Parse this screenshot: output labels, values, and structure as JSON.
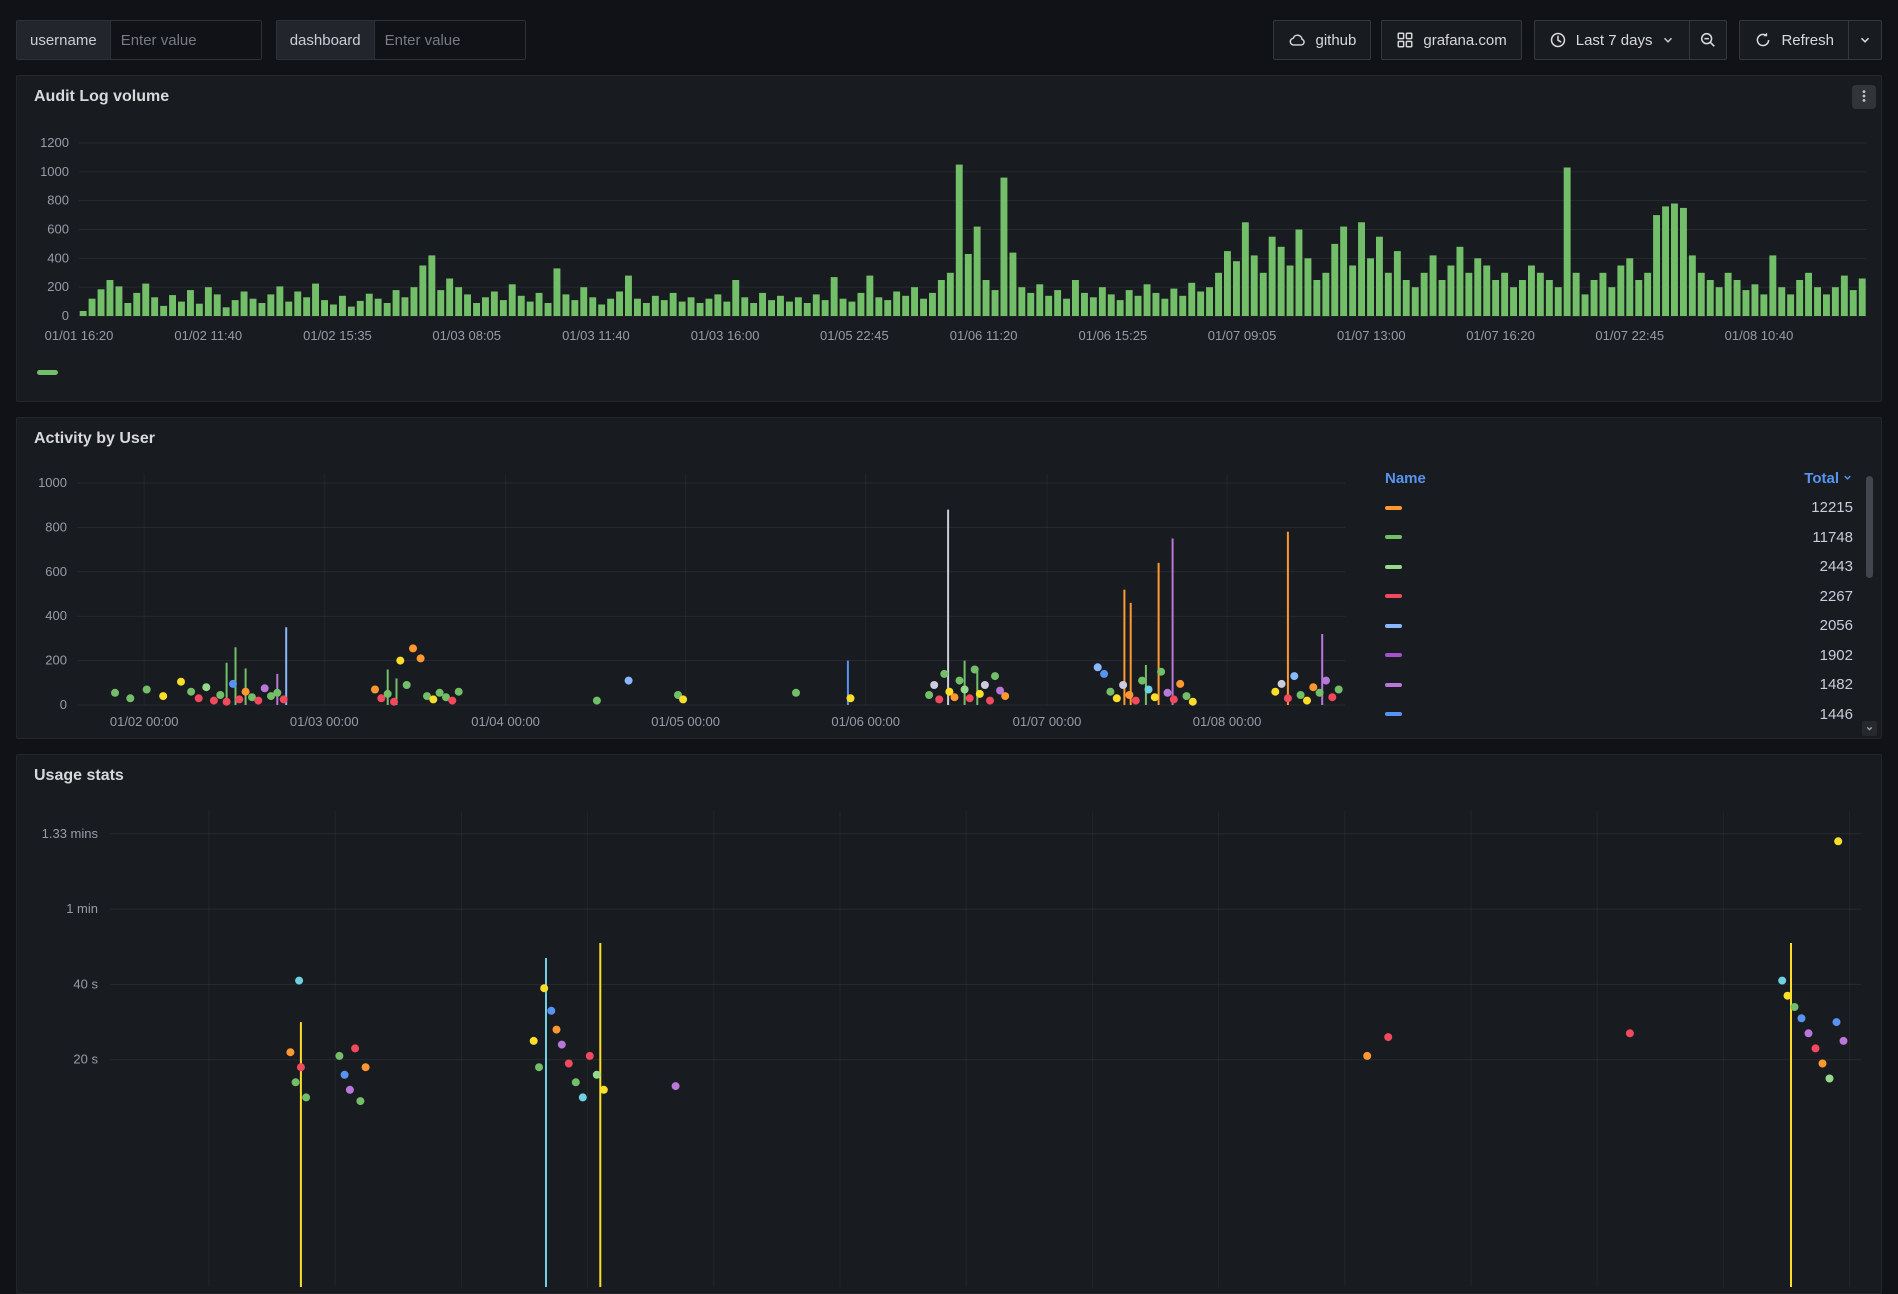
{
  "topbar": {
    "variables": [
      {
        "label": "username",
        "placeholder": "Enter value"
      },
      {
        "label": "dashboard",
        "placeholder": "Enter value"
      }
    ],
    "github_label": "github",
    "grafana_label": "grafana.com",
    "time_range_label": "Last 7 days",
    "refresh_label": "Refresh"
  },
  "icons": [
    "cloud-icon",
    "apps-grid-icon",
    "clock-icon",
    "chevron-down-icon",
    "zoom-out-icon",
    "refresh-icon",
    "kebab-menu-icon",
    "sort-desc-icon",
    "scroll-down-icon"
  ],
  "palette": {
    "G": "#73bf69",
    "Y": "#fade2a",
    "O": "#ff9830",
    "R": "#f2495c",
    "B": "#5794f2",
    "P": "#b877d9",
    "LB": "#8ab8ff",
    "LG": "#96d98d",
    "T": "#6ed0e0",
    "W": "#ccccdc",
    "V": "#a352cc"
  },
  "chart_data": [
    {
      "id": "audit",
      "type": "bar",
      "title": "Audit Log volume",
      "color": "#73bf69",
      "ylim": [
        0,
        1200
      ],
      "yticks": [
        0,
        200,
        400,
        600,
        800,
        1000,
        1200
      ],
      "xticks": [
        "01/01 16:20",
        "01/02 11:40",
        "01/02 15:35",
        "01/03 08:05",
        "01/03 11:40",
        "01/03 16:00",
        "01/05 22:45",
        "01/06 11:20",
        "01/06 15:25",
        "01/07 09:05",
        "01/07 13:00",
        "01/07 16:20",
        "01/07 22:45",
        "01/08 10:40"
      ],
      "values": [
        35,
        120,
        185,
        250,
        205,
        90,
        160,
        225,
        130,
        70,
        145,
        100,
        180,
        85,
        200,
        150,
        60,
        110,
        170,
        120,
        90,
        150,
        205,
        100,
        170,
        130,
        225,
        110,
        80,
        140,
        65,
        105,
        155,
        120,
        90,
        180,
        130,
        200,
        350,
        420,
        180,
        260,
        200,
        150,
        90,
        130,
        170,
        110,
        220,
        140,
        100,
        160,
        90,
        330,
        150,
        110,
        200,
        130,
        80,
        120,
        170,
        280,
        120,
        90,
        140,
        110,
        160,
        100,
        130,
        90,
        120,
        150,
        100,
        250,
        130,
        90,
        160,
        110,
        140,
        100,
        130,
        90,
        150,
        110,
        270,
        120,
        100,
        160,
        280,
        130,
        110,
        170,
        140,
        200,
        120,
        160,
        250,
        300,
        1050,
        430,
        620,
        250,
        180,
        960,
        440,
        200,
        160,
        220,
        140,
        180,
        120,
        250,
        160,
        130,
        200,
        150,
        110,
        180,
        140,
        220,
        160,
        120,
        190,
        140,
        230,
        170,
        200,
        300,
        450,
        380,
        650,
        420,
        300,
        550,
        480,
        350,
        600,
        400,
        250,
        300,
        500,
        620,
        350,
        650,
        400,
        550,
        300,
        450,
        250,
        200,
        300,
        420,
        250,
        350,
        480,
        300,
        400,
        350,
        250,
        300,
        200,
        250,
        350,
        300,
        250,
        200,
        1030,
        300,
        150,
        250,
        300,
        200,
        350,
        400,
        250,
        300,
        700,
        760,
        780,
        750,
        420,
        300,
        250,
        200,
        300,
        250,
        180,
        220,
        150,
        420,
        200,
        150,
        250,
        300,
        200,
        150,
        200,
        280,
        180,
        260
      ]
    },
    {
      "id": "activity",
      "type": "scatter",
      "title": "Activity by User",
      "ylim": [
        0,
        1000
      ],
      "yticks": [
        0,
        200,
        400,
        600,
        800,
        1000
      ],
      "xticks": [
        {
          "label": "01/02 00:00",
          "f": 0.053
        },
        {
          "label": "01/03 00:00",
          "f": 0.195
        },
        {
          "label": "01/04 00:00",
          "f": 0.338
        },
        {
          "label": "01/05 00:00",
          "f": 0.48
        },
        {
          "label": "01/06 00:00",
          "f": 0.622
        },
        {
          "label": "01/07 00:00",
          "f": 0.765
        },
        {
          "label": "01/08 00:00",
          "f": 0.907
        }
      ],
      "points": [
        [
          0.03,
          55,
          "G"
        ],
        [
          0.042,
          30,
          "G"
        ],
        [
          0.055,
          70,
          "G"
        ],
        [
          0.068,
          40,
          "Y"
        ],
        [
          0.082,
          105,
          "Y"
        ],
        [
          0.09,
          60,
          "G"
        ],
        [
          0.096,
          30,
          "R"
        ],
        [
          0.102,
          80,
          "LG"
        ],
        [
          0.108,
          20,
          "R"
        ],
        [
          0.113,
          45,
          "G"
        ],
        [
          0.118,
          15,
          "R"
        ],
        [
          0.123,
          95,
          "B"
        ],
        [
          0.128,
          25,
          "R"
        ],
        [
          0.133,
          60,
          "O"
        ],
        [
          0.138,
          35,
          "G"
        ],
        [
          0.143,
          20,
          "R"
        ],
        [
          0.148,
          75,
          "P"
        ],
        [
          0.153,
          40,
          "G"
        ],
        [
          0.158,
          55,
          "G"
        ],
        [
          0.163,
          25,
          "R"
        ],
        [
          0.235,
          70,
          "O"
        ],
        [
          0.24,
          30,
          "R"
        ],
        [
          0.245,
          50,
          "G"
        ],
        [
          0.25,
          15,
          "R"
        ],
        [
          0.255,
          200,
          "Y"
        ],
        [
          0.26,
          90,
          "G"
        ],
        [
          0.265,
          255,
          "O"
        ],
        [
          0.271,
          210,
          "O"
        ],
        [
          0.276,
          40,
          "G"
        ],
        [
          0.281,
          25,
          "Y"
        ],
        [
          0.286,
          55,
          "G"
        ],
        [
          0.291,
          35,
          "G"
        ],
        [
          0.296,
          20,
          "R"
        ],
        [
          0.301,
          60,
          "G"
        ],
        [
          0.41,
          20,
          "G"
        ],
        [
          0.435,
          110,
          "LB"
        ],
        [
          0.474,
          45,
          "G"
        ],
        [
          0.478,
          25,
          "Y"
        ],
        [
          0.567,
          55,
          "G"
        ],
        [
          0.61,
          30,
          "Y"
        ],
        [
          0.672,
          45,
          "G"
        ],
        [
          0.676,
          90,
          "W"
        ],
        [
          0.68,
          25,
          "R"
        ],
        [
          0.684,
          140,
          "G"
        ],
        [
          0.688,
          60,
          "Y"
        ],
        [
          0.692,
          35,
          "O"
        ],
        [
          0.696,
          110,
          "G"
        ],
        [
          0.7,
          70,
          "LG"
        ],
        [
          0.704,
          30,
          "R"
        ],
        [
          0.708,
          160,
          "G"
        ],
        [
          0.712,
          50,
          "Y"
        ],
        [
          0.716,
          90,
          "W"
        ],
        [
          0.72,
          20,
          "R"
        ],
        [
          0.724,
          130,
          "G"
        ],
        [
          0.728,
          65,
          "P"
        ],
        [
          0.732,
          40,
          "O"
        ],
        [
          0.805,
          170,
          "LB"
        ],
        [
          0.81,
          140,
          "B"
        ],
        [
          0.815,
          60,
          "G"
        ],
        [
          0.82,
          30,
          "Y"
        ],
        [
          0.825,
          90,
          "W"
        ],
        [
          0.83,
          45,
          "O"
        ],
        [
          0.835,
          20,
          "R"
        ],
        [
          0.84,
          110,
          "G"
        ],
        [
          0.845,
          70,
          "T"
        ],
        [
          0.85,
          35,
          "Y"
        ],
        [
          0.855,
          150,
          "G"
        ],
        [
          0.86,
          55,
          "P"
        ],
        [
          0.865,
          25,
          "R"
        ],
        [
          0.87,
          95,
          "O"
        ],
        [
          0.875,
          40,
          "G"
        ],
        [
          0.88,
          15,
          "Y"
        ],
        [
          0.945,
          60,
          "Y"
        ],
        [
          0.95,
          95,
          "W"
        ],
        [
          0.955,
          30,
          "R"
        ],
        [
          0.96,
          130,
          "LB"
        ],
        [
          0.965,
          45,
          "G"
        ],
        [
          0.97,
          20,
          "Y"
        ],
        [
          0.975,
          80,
          "O"
        ],
        [
          0.98,
          55,
          "G"
        ],
        [
          0.985,
          110,
          "P"
        ],
        [
          0.99,
          35,
          "R"
        ],
        [
          0.995,
          70,
          "G"
        ]
      ],
      "lines": [
        [
          0.118,
          190,
          "G"
        ],
        [
          0.125,
          260,
          "G"
        ],
        [
          0.133,
          165,
          "G"
        ],
        [
          0.158,
          140,
          "P"
        ],
        [
          0.165,
          350,
          "LB"
        ],
        [
          0.245,
          160,
          "G"
        ],
        [
          0.252,
          120,
          "G"
        ],
        [
          0.608,
          200,
          "B"
        ],
        [
          0.687,
          880,
          "W"
        ],
        [
          0.7,
          200,
          "G"
        ],
        [
          0.71,
          170,
          "G"
        ],
        [
          0.826,
          520,
          "O"
        ],
        [
          0.831,
          460,
          "O"
        ],
        [
          0.843,
          180,
          "G"
        ],
        [
          0.853,
          640,
          "O"
        ],
        [
          0.864,
          750,
          "P"
        ],
        [
          0.955,
          780,
          "O"
        ],
        [
          0.982,
          320,
          "P"
        ]
      ],
      "legend_table": {
        "columns": [
          "Name",
          "Total"
        ],
        "rows": [
          {
            "color": "#ff9830",
            "name": "",
            "total": "12215"
          },
          {
            "color": "#73bf69",
            "name": "",
            "total": "11748"
          },
          {
            "color": "#96d98d",
            "name": "",
            "total": "2443"
          },
          {
            "color": "#f2495c",
            "name": "",
            "total": "2267"
          },
          {
            "color": "#8ab8ff",
            "name": "",
            "total": "2056"
          },
          {
            "color": "#a352cc",
            "name": "",
            "total": "1902"
          },
          {
            "color": "#b877d9",
            "name": "",
            "total": "1482"
          },
          {
            "color": "#5794f2",
            "name": "",
            "total": "1446"
          }
        ]
      }
    },
    {
      "id": "usage",
      "type": "scatter",
      "title": "Usage stats",
      "yticks": [
        {
          "label": "1.33 mins",
          "s": 80
        },
        {
          "label": "1 min",
          "s": 60
        },
        {
          "label": "40 s",
          "s": 40
        },
        {
          "label": "20 s",
          "s": 20
        }
      ],
      "points": [
        [
          0.108,
          41,
          "T"
        ],
        [
          0.103,
          22,
          "O"
        ],
        [
          0.106,
          14,
          "G"
        ],
        [
          0.109,
          18,
          "R"
        ],
        [
          0.112,
          10,
          "G"
        ],
        [
          0.131,
          21,
          "G"
        ],
        [
          0.134,
          16,
          "B"
        ],
        [
          0.137,
          12,
          "P"
        ],
        [
          0.14,
          23,
          "R"
        ],
        [
          0.143,
          9,
          "G"
        ],
        [
          0.146,
          18,
          "O"
        ],
        [
          0.242,
          25,
          "Y"
        ],
        [
          0.245,
          18,
          "G"
        ],
        [
          0.248,
          39,
          "Y"
        ],
        [
          0.252,
          33,
          "B"
        ],
        [
          0.255,
          28,
          "O"
        ],
        [
          0.258,
          24,
          "P"
        ],
        [
          0.262,
          19,
          "R"
        ],
        [
          0.266,
          14,
          "G"
        ],
        [
          0.27,
          10,
          "T"
        ],
        [
          0.274,
          21,
          "R"
        ],
        [
          0.278,
          16,
          "LG"
        ],
        [
          0.282,
          12,
          "Y"
        ],
        [
          0.323,
          13,
          "P"
        ],
        [
          0.718,
          21,
          "O"
        ],
        [
          0.73,
          26,
          "R"
        ],
        [
          0.868,
          27,
          "R"
        ],
        [
          0.955,
          41,
          "T"
        ],
        [
          0.958,
          37,
          "Y"
        ],
        [
          0.962,
          34,
          "G"
        ],
        [
          0.966,
          31,
          "B"
        ],
        [
          0.97,
          27,
          "P"
        ],
        [
          0.974,
          23,
          "R"
        ],
        [
          0.978,
          19,
          "O"
        ],
        [
          0.982,
          15,
          "LG"
        ],
        [
          0.986,
          30,
          "B"
        ],
        [
          0.99,
          25,
          "P"
        ],
        [
          0.987,
          78,
          "Y"
        ]
      ],
      "lines": [
        [
          0.109,
          30,
          "Y"
        ],
        [
          0.249,
          47,
          "T"
        ],
        [
          0.28,
          51,
          "Y"
        ],
        [
          0.96,
          51,
          "Y"
        ]
      ]
    }
  ]
}
